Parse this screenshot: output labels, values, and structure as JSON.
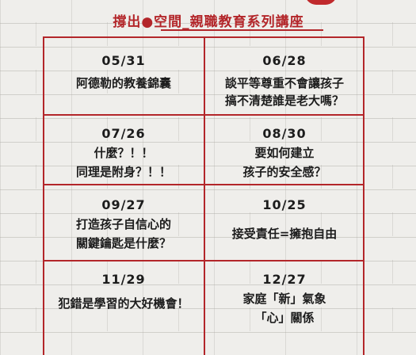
{
  "header": {
    "title": "撐出●空間_親職教育系列講座"
  },
  "lectures": [
    {
      "date": "05/31",
      "lines": [
        "阿德勒的教養錦囊"
      ]
    },
    {
      "date": "06/28",
      "lines": [
        "談平等尊重不會讓孩子",
        "搞不清楚誰是老大嗎？"
      ]
    },
    {
      "date": "07/26",
      "lines": [
        "什麼？！！",
        "同理是附身？！！"
      ]
    },
    {
      "date": "08/30",
      "lines": [
        "要如何建立",
        "孩子的安全感？"
      ]
    },
    {
      "date": "09/27",
      "lines": [
        "打造孩子自信心的",
        "關鍵鑰匙是什麼？"
      ]
    },
    {
      "date": "10/25",
      "lines": [
        "接受責任=擁抱自由"
      ]
    },
    {
      "date": "11/29",
      "lines": [
        "犯錯是學習的大好機會！"
      ]
    },
    {
      "date": "12/27",
      "lines": [
        "家庭「新」氣象",
        "「心」關係"
      ]
    }
  ],
  "colors": {
    "accent": "#b3262a",
    "text": "#1c1c1c",
    "wall": "#efeeeb"
  }
}
